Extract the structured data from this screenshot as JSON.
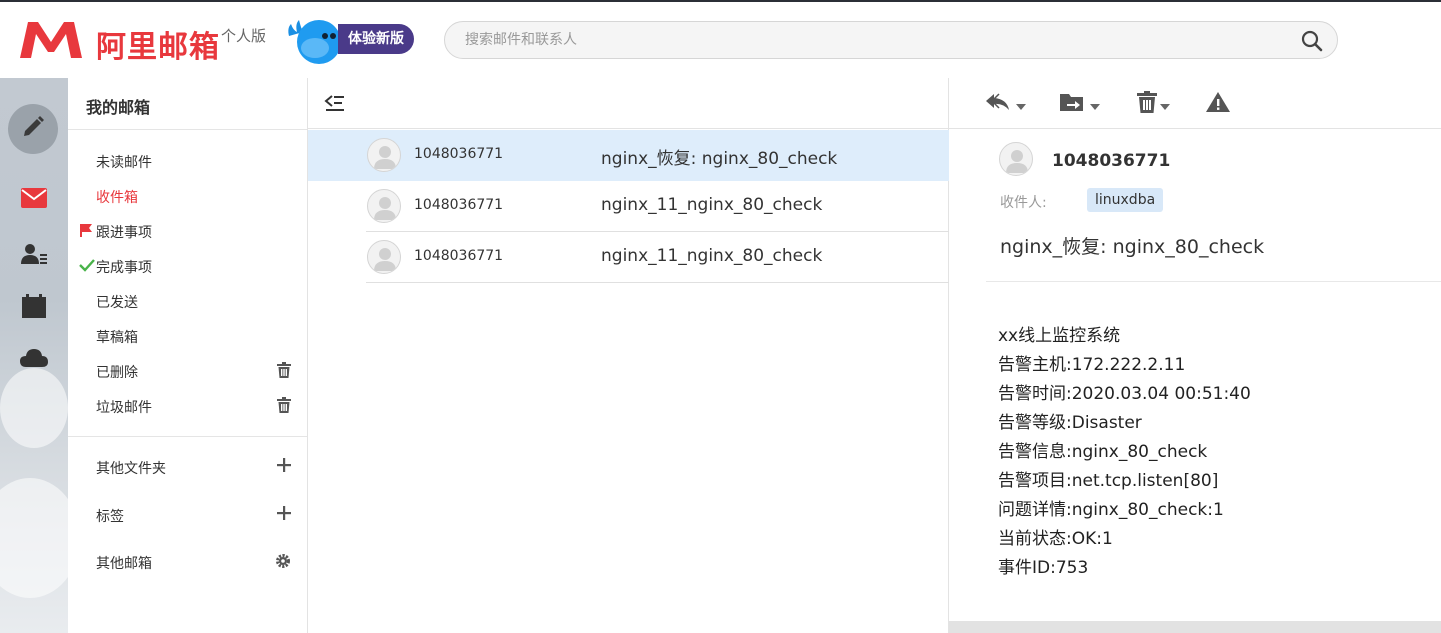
{
  "header": {
    "brand": "阿里邮箱",
    "edition": "个人版",
    "new_version_label": "体验新版",
    "search_placeholder": "搜索邮件和联系人",
    "brand_color": "#e8383d"
  },
  "rail": {
    "icons": [
      "compose-icon",
      "mail-icon",
      "contacts-icon",
      "calendar-icon",
      "cloud-icon"
    ]
  },
  "folders": {
    "title": "我的邮箱",
    "items": [
      {
        "label": "未读邮件"
      },
      {
        "label": "收件箱",
        "active": true
      },
      {
        "label": "跟进事项",
        "prefix": "flag-icon"
      },
      {
        "label": "完成事项",
        "prefix": "check-icon"
      },
      {
        "label": "已发送"
      },
      {
        "label": "草稿箱"
      },
      {
        "label": "已删除",
        "action": "trash-icon"
      },
      {
        "label": "垃圾邮件",
        "action": "trash-icon"
      }
    ],
    "other_folders": "其他文件夹",
    "tags": "标签",
    "other_mailboxes": "其他邮箱"
  },
  "messages": [
    {
      "from": "1048036771",
      "subject": "nginx_恢复: nginx_80_check",
      "selected": true
    },
    {
      "from": "1048036771",
      "subject": "nginx_11_nginx_80_check",
      "selected": false
    },
    {
      "from": "1048036771",
      "subject": "nginx_11_nginx_80_check",
      "selected": false
    }
  ],
  "reading": {
    "sender": "1048036771",
    "to_label": "收件人:",
    "to_value": "linuxdba",
    "subject": "nginx_恢复: nginx_80_check",
    "body_lines": [
      "xx线上监控系统",
      "告警主机:172.222.2.11",
      "告警时间:2020.03.04 00:51:40",
      "告警等级:Disaster",
      "告警信息:nginx_80_check",
      "告警项目:net.tcp.listen[80]",
      "问题详情:nginx_80_check:1",
      "当前状态:OK:1",
      "事件ID:753"
    ]
  }
}
